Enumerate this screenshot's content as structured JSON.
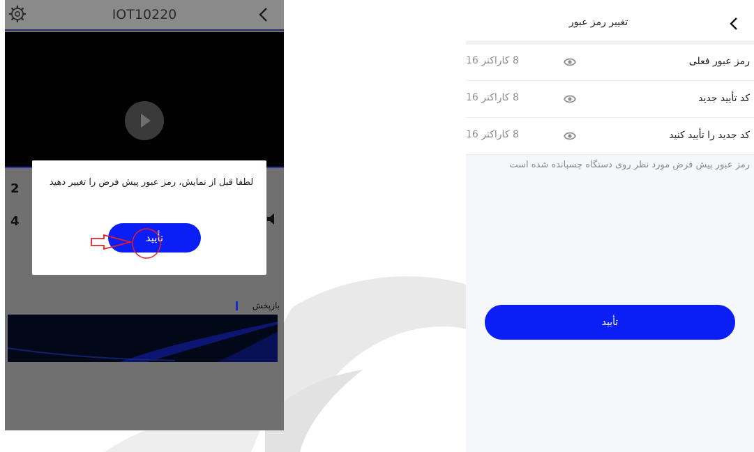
{
  "left_screen": {
    "device_title": "IOT10220",
    "icons": {
      "settings": "gear-icon",
      "back": "chevron-left-icon",
      "play": "play-icon"
    },
    "side_glyphs": [
      "2",
      "4"
    ],
    "playback": {
      "label": "بازپخش"
    },
    "dialog": {
      "message": "لطفا قبل از نمایش، رمز عبور پیش فرض را تغییر دهید",
      "confirm_label": "تأیید"
    }
  },
  "right_screen": {
    "header": {
      "title": "تغییر رمز عبور"
    },
    "fields": [
      {
        "label": "رمز عبور فعلی",
        "hint": "8 کاراکتر 16"
      },
      {
        "label": "کد تأیید جدید",
        "hint": "8 کاراکتر 16"
      },
      {
        "label": "کد جدید را تأیید کنید",
        "hint": "8 کاراکتر 16"
      }
    ],
    "note": "رمز عبور پیش فرض مورد نظر روی دستگاه چسبانده شده است",
    "confirm_label": "تأیید"
  },
  "colors": {
    "accent": "#0a1ef5",
    "annotation": "#e0202a",
    "overlay": "#707070"
  }
}
